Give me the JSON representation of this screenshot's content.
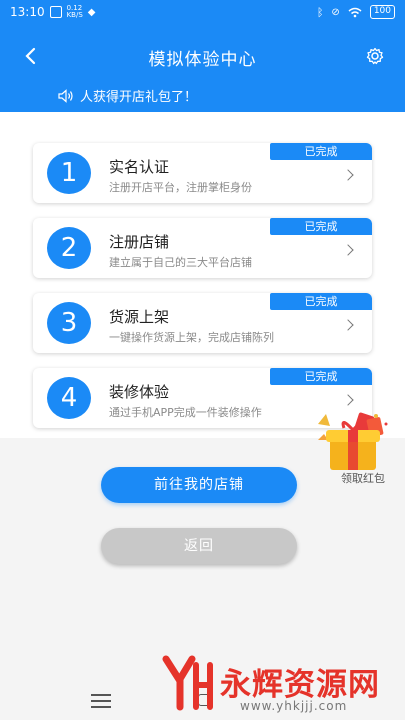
{
  "status_bar": {
    "time": "13:10",
    "speed": "0.12",
    "speed_unit": "KB/S",
    "battery": "100"
  },
  "header": {
    "title": "模拟体验中心",
    "back_icon": "chevron-left-icon",
    "settings_icon": "gear-icon"
  },
  "notice": {
    "icon": "speaker-icon",
    "text": "人获得开店礼包了！"
  },
  "steps": [
    {
      "number": "1",
      "title": "实名认证",
      "desc": "注册开店平台，注册掌柜身份",
      "status": "已完成"
    },
    {
      "number": "2",
      "title": "注册店铺",
      "desc": "建立属于自己的三大平台店铺",
      "status": "已完成"
    },
    {
      "number": "3",
      "title": "货源上架",
      "desc": "一键操作货源上架，完成店铺陈列",
      "status": "已完成"
    },
    {
      "number": "4",
      "title": "装修体验",
      "desc": "通过手机APP完成一件装修操作",
      "status": "已完成"
    }
  ],
  "buttons": {
    "primary": "前往我的店铺",
    "back": "返回"
  },
  "gift": {
    "label": "领取红包",
    "icon": "red-packet-gift-icon"
  },
  "watermark": {
    "text": "永辉资源网",
    "url": "www.yhkjjj.com"
  },
  "colors": {
    "accent": "#1b8af6",
    "disabled": "#c8c8c8",
    "watermark": "#e5332a"
  }
}
